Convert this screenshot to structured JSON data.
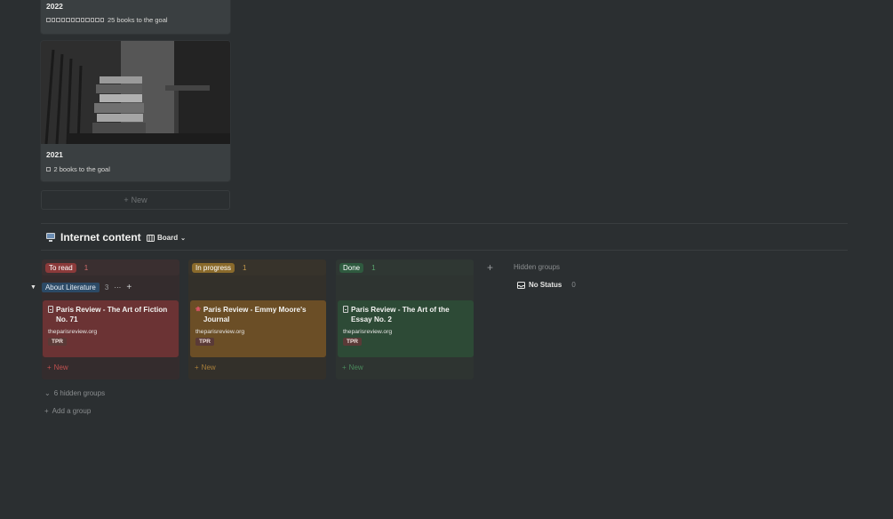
{
  "gallery": {
    "cards": [
      {
        "title": "2022",
        "progress_text": "25 books to the goal"
      },
      {
        "title": "2021",
        "progress_text": "2 books to the goal"
      }
    ],
    "new_label": "New"
  },
  "section": {
    "title": "Internet content",
    "view_label": "Board",
    "hidden_groups_label": "Hidden groups",
    "no_status_label": "No Status",
    "no_status_count": "0"
  },
  "columns": [
    {
      "label": "To read",
      "count": "1",
      "pill_color": "#8b3a3a",
      "bg": "#3a2f30",
      "count_color": "#d06b6b"
    },
    {
      "label": "In progress",
      "count": "1",
      "pill_color": "#8a6a2b",
      "bg": "#37332b",
      "count_color": "#c49a4c"
    },
    {
      "label": "Done",
      "count": "1",
      "pill_color": "#2f5a3f",
      "bg": "#2f3733",
      "count_color": "#5aa56e"
    }
  ],
  "group": {
    "label": "About Literature",
    "count": "3",
    "more": "···",
    "add": "+"
  },
  "cards": [
    {
      "title": "Paris Review - The Art of Fiction No. 71",
      "url": "theparisreview.org",
      "tag": "TPR",
      "bg": "#6b3334"
    },
    {
      "title": "Paris Review - Emmy Moore's Journal",
      "url": "theparisreview.org",
      "tag": "TPR",
      "bg": "#6b4e26"
    },
    {
      "title": "Paris Review - The Art of the Essay No. 2",
      "url": "theparisreview.org",
      "tag": "TPR",
      "bg": "#2d4a36"
    }
  ],
  "new_card_label": "New",
  "footer": {
    "hidden_groups": "6 hidden groups",
    "add_group": "Add a group"
  },
  "icons": {
    "page": "document-icon",
    "board": "board-icon",
    "inbox": "inbox-icon"
  }
}
